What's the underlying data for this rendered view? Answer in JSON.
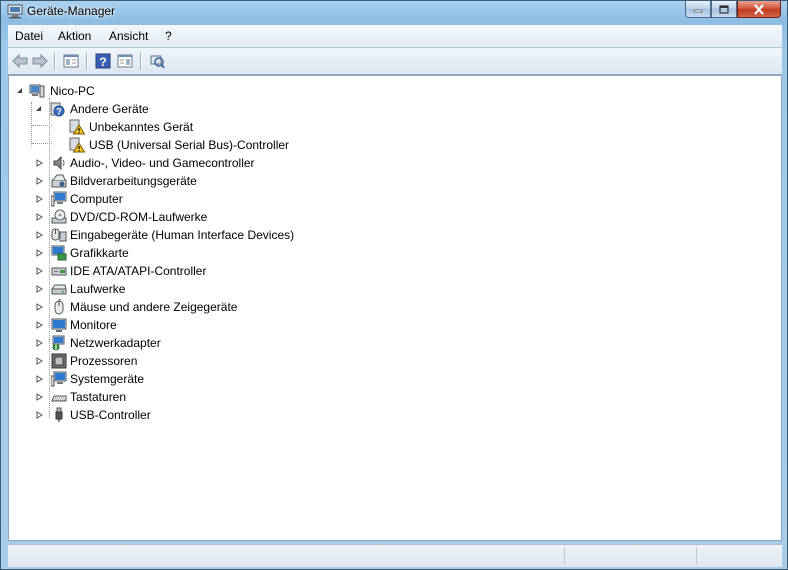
{
  "window": {
    "title": "Geräte-Manager"
  },
  "menu": {
    "items": [
      "Datei",
      "Aktion",
      "Ansicht",
      "?"
    ]
  },
  "toolbar": {
    "buttons": [
      "back-icon",
      "forward-icon",
      "show-hide-console-tree-icon",
      "help-icon",
      "properties-icon",
      "scan-hardware-icon"
    ]
  },
  "tree": {
    "root": "Nico-PC",
    "other_devices": {
      "label": "Andere Geräte",
      "children": [
        "Unbekanntes Gerät",
        "USB (Universal Serial Bus)-Controller"
      ]
    },
    "categories": [
      {
        "label": "Audio-, Video- und Gamecontroller",
        "icon": "speaker-icon"
      },
      {
        "label": "Bildverarbeitungsgeräte",
        "icon": "camera-scanner-icon"
      },
      {
        "label": "Computer",
        "icon": "computer-icon"
      },
      {
        "label": "DVD/CD-ROM-Laufwerke",
        "icon": "optical-drive-icon"
      },
      {
        "label": "Eingabegeräte (Human Interface Devices)",
        "icon": "hid-icon"
      },
      {
        "label": "Grafikkarte",
        "icon": "display-adapter-icon"
      },
      {
        "label": "IDE ATA/ATAPI-Controller",
        "icon": "ide-controller-icon"
      },
      {
        "label": "Laufwerke",
        "icon": "disk-drive-icon"
      },
      {
        "label": "Mäuse und andere Zeigegeräte",
        "icon": "mouse-icon"
      },
      {
        "label": "Monitore",
        "icon": "monitor-icon"
      },
      {
        "label": "Netzwerkadapter",
        "icon": "network-adapter-icon"
      },
      {
        "label": "Prozessoren",
        "icon": "processor-icon"
      },
      {
        "label": "Systemgeräte",
        "icon": "system-device-icon"
      },
      {
        "label": "Tastaturen",
        "icon": "keyboard-icon"
      },
      {
        "label": "USB-Controller",
        "icon": "usb-icon"
      }
    ]
  }
}
